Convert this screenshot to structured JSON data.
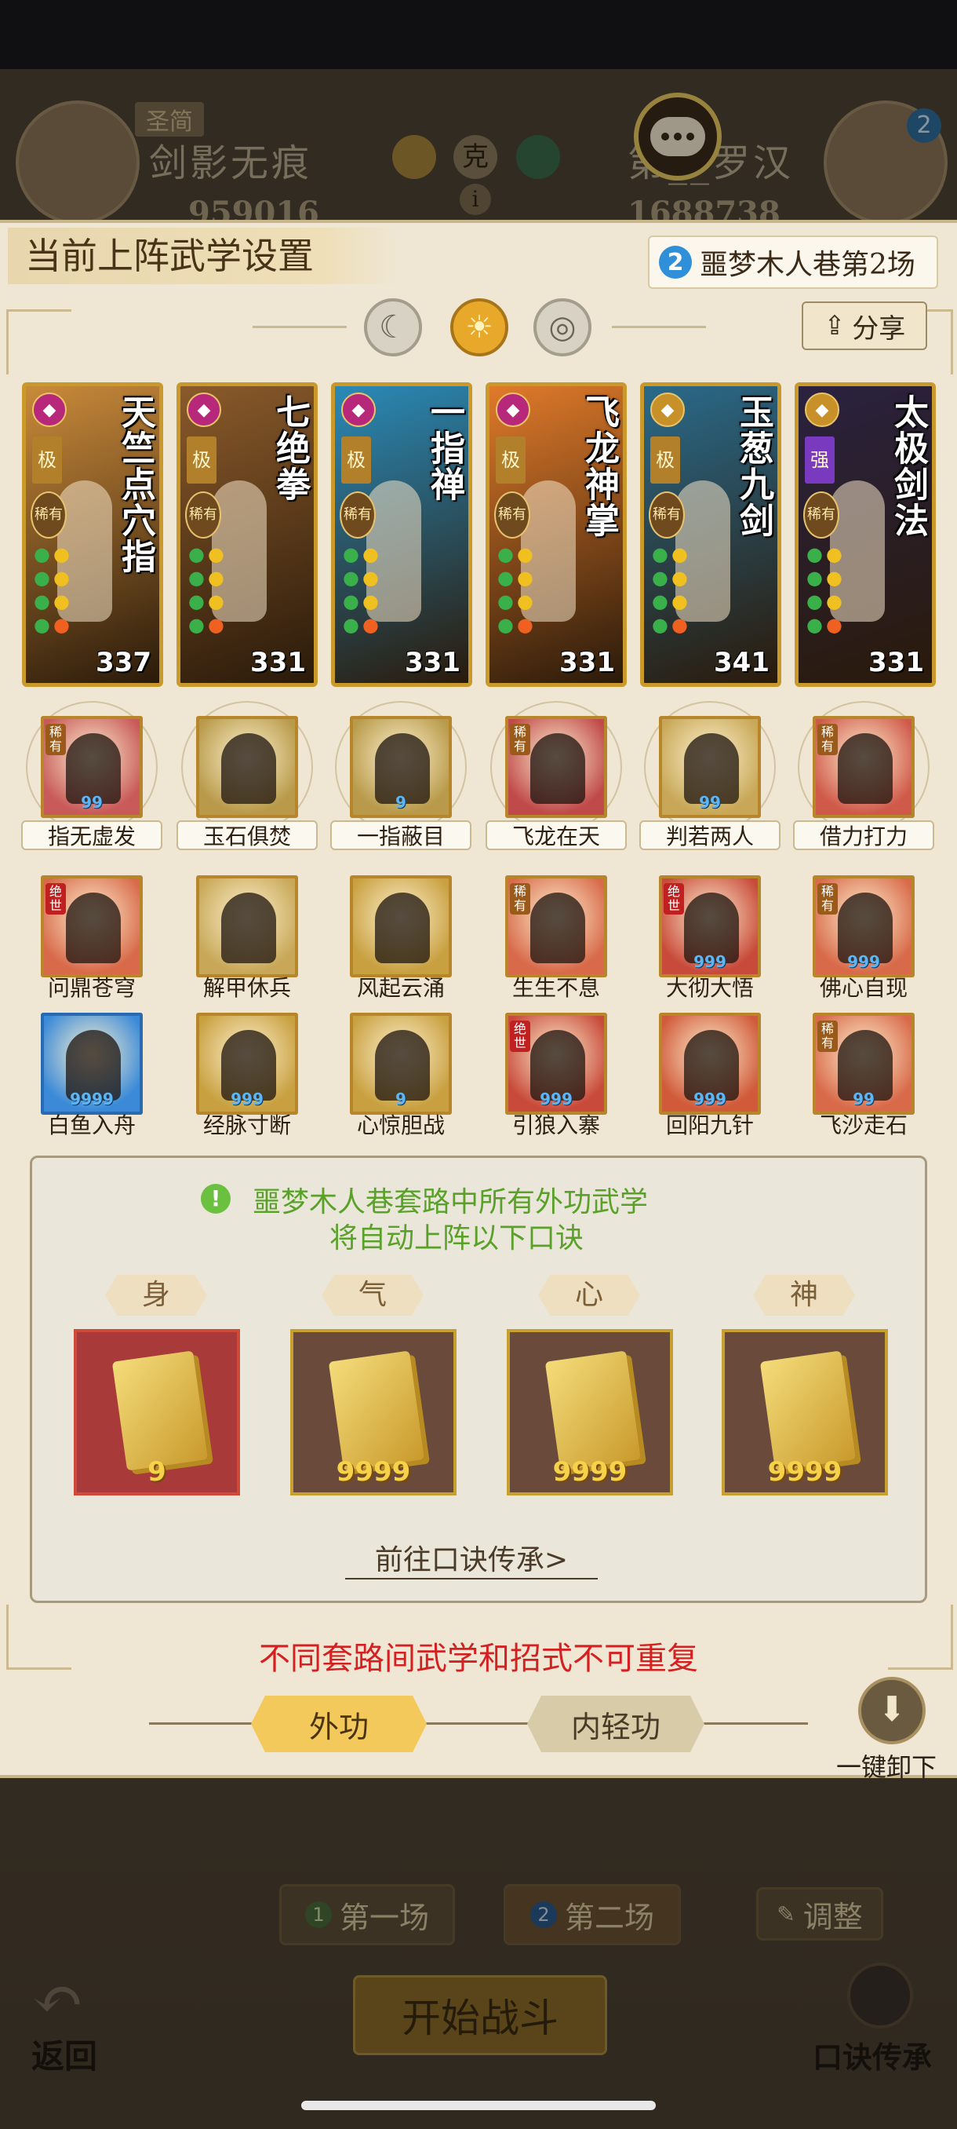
{
  "background": {
    "left_player": {
      "name": "剑影无痕",
      "rank": "圣简",
      "power": "959016"
    },
    "right_player": {
      "name": "第__罗汉",
      "power": "1688738",
      "badge": "2"
    },
    "vs_label": "克",
    "buttons": {
      "field1": "第一场",
      "field1_num": "1",
      "field2": "第二场",
      "field2_num": "2",
      "adjust": "调整",
      "start": "开始战斗",
      "back": "返回",
      "mnemonic": "口诀传承"
    }
  },
  "panel": {
    "title": "当前上阵武学设置",
    "stage": {
      "num": "2",
      "label": "噩梦木人巷第2场"
    },
    "share": "分享",
    "modes": [
      "moon",
      "sun",
      "ring"
    ]
  },
  "cards": [
    {
      "name": "天竺点穴指",
      "rank": "极",
      "power": "337",
      "color": "#c98a3a"
    },
    {
      "name": "七绝拳",
      "rank": "极",
      "power": "331",
      "color": "#8a5a2a"
    },
    {
      "name": "一指禅",
      "rank": "极",
      "power": "331",
      "color": "#2a8ab8"
    },
    {
      "name": "飞龙神掌",
      "rank": "极",
      "power": "331",
      "color": "#e07a2a"
    },
    {
      "name": "玉葱九剑",
      "rank": "极",
      "power": "341",
      "color": "#2a6a8a"
    },
    {
      "name": "太极剑法",
      "rank": "强",
      "power": "331",
      "color": "#2a2240"
    }
  ],
  "tier_label": "稀有",
  "skills_row1": [
    {
      "name": "指无虚发",
      "count": "99",
      "tag": "稀有",
      "color": "#c85a5a"
    },
    {
      "name": "玉石俱焚",
      "count": "",
      "tag": "",
      "color": "#b89a4a"
    },
    {
      "name": "一指蔽目",
      "count": "9",
      "tag": "",
      "color": "#b89a4a"
    },
    {
      "name": "飞龙在天",
      "count": "",
      "tag": "稀有",
      "color": "#c04a4a"
    },
    {
      "name": "判若两人",
      "count": "99",
      "tag": "",
      "color": "#c8a858"
    },
    {
      "name": "借力打力",
      "count": "",
      "tag": "稀有",
      "color": "#d05a4a"
    }
  ],
  "skills_row2": [
    {
      "name": "问鼎苍穹",
      "count": "",
      "tag": "绝世",
      "color": "#d86a4a"
    },
    {
      "name": "解甲休兵",
      "count": "",
      "tag": "",
      "color": "#c8a858"
    },
    {
      "name": "风起云涌",
      "count": "",
      "tag": "",
      "color": "#c8a040"
    },
    {
      "name": "生生不息",
      "count": "",
      "tag": "稀有",
      "color": "#d86a4a"
    },
    {
      "name": "大彻大悟",
      "count": "999",
      "tag": "绝世",
      "color": "#c84a3a"
    },
    {
      "name": "佛心自现",
      "count": "999",
      "tag": "稀有",
      "color": "#d86a4a"
    }
  ],
  "skills_row3": [
    {
      "name": "白鱼入舟",
      "count": "9999",
      "tag": "",
      "color": "#3a8ad8"
    },
    {
      "name": "经脉寸断",
      "count": "999",
      "tag": "",
      "color": "#c8a040"
    },
    {
      "name": "心惊胆战",
      "count": "9",
      "tag": "",
      "color": "#c8a040"
    },
    {
      "name": "引狼入寨",
      "count": "999",
      "tag": "绝世",
      "color": "#c84a3a"
    },
    {
      "name": "回阳九针",
      "count": "999",
      "tag": "",
      "color": "#d05a3a"
    },
    {
      "name": "飞沙走石",
      "count": "99",
      "tag": "稀有",
      "color": "#d86a4a"
    }
  ],
  "mnemonic": {
    "line1": "噩梦木人巷套路中所有外功武学",
    "line2": "将自动上阵以下口诀",
    "info_icon": "!",
    "slots": [
      {
        "label": "身",
        "count": "9",
        "color": "#a83a3a"
      },
      {
        "label": "气",
        "count": "9999",
        "color": "#6a4a3a"
      },
      {
        "label": "心",
        "count": "9999",
        "color": "#6a4a3a"
      },
      {
        "label": "神",
        "count": "9999",
        "color": "#6a4a3a"
      }
    ],
    "link": "前往口诀传承>"
  },
  "warning": "不同套路间武学和招式不可重复",
  "tabs": {
    "outer": "外功",
    "inner": "内轻功"
  },
  "unload": "一键卸下"
}
